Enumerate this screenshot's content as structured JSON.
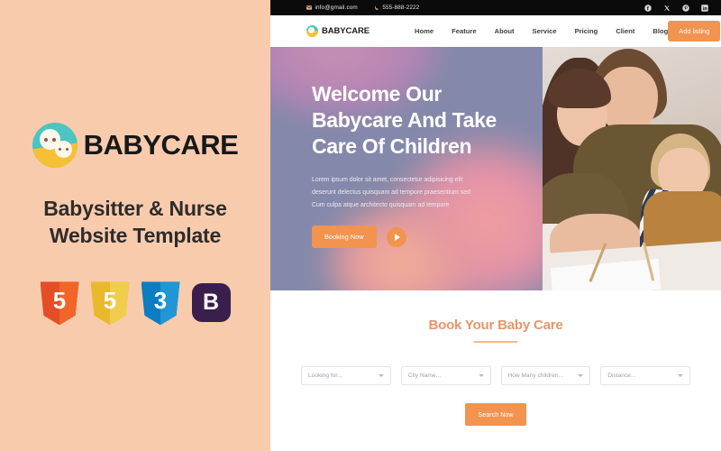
{
  "promo": {
    "brand_name": "BABYCARE",
    "brand_icon": "babycare-logo-icon",
    "title_line_1": "Babysitter & Nurse",
    "title_line_2": "Website Template",
    "panel_bg": "#f9cbad",
    "title_color": "#2e2c2b",
    "badges": [
      {
        "name": "html5-badge",
        "letter": "5"
      },
      {
        "name": "js-badge",
        "letter": "5"
      },
      {
        "name": "css3-badge",
        "letter": "3"
      },
      {
        "name": "bootstrap-badge",
        "letter": "B"
      }
    ]
  },
  "site": {
    "topbar": {
      "email": "info@gmail.com",
      "phone": "555-888-2222",
      "email_icon": "envelope-icon",
      "phone_icon": "phone-icon",
      "bg": "#0b0b0b",
      "socials": [
        {
          "name": "facebook-icon"
        },
        {
          "name": "x-twitter-icon"
        },
        {
          "name": "pinterest-icon"
        },
        {
          "name": "linkedin-icon"
        }
      ]
    },
    "nav": {
      "brand": "BABYCARE",
      "brand_icon": "babycare-logo-icon",
      "links": [
        {
          "label": "Home"
        },
        {
          "label": "Feature"
        },
        {
          "label": "About"
        },
        {
          "label": "Service"
        },
        {
          "label": "Pricing"
        },
        {
          "label": "Client"
        },
        {
          "label": "Blog"
        }
      ],
      "cta_label": "Add listing",
      "accent": "#f2934f"
    },
    "hero": {
      "title_line_1": "Welcome Our",
      "title_line_2": "Babycare And Take",
      "title_line_3": "Care Of Children",
      "desc_line_1": "Lorem ipsum dolor sit amet, consectetur adipisicing elit",
      "desc_line_2": "deserunt delectus quisquam ad tempore praesentium sed",
      "desc_line_3": "Cum culpa atque architecto quisquam ad tempore",
      "cta_label": "Booking Now",
      "play_icon": "play-icon",
      "bg_color": "#8489ab"
    },
    "booking": {
      "title": "Book Your Baby Care",
      "title_color": "#e8956a",
      "fields": [
        {
          "name": "looking-for-select",
          "placeholder": "Looking for..."
        },
        {
          "name": "city-name-select",
          "placeholder": "City Name..."
        },
        {
          "name": "children-count-select",
          "placeholder": "How Many children..."
        },
        {
          "name": "distance-select",
          "placeholder": "Distance..."
        }
      ],
      "search_label": "Search Now"
    }
  }
}
